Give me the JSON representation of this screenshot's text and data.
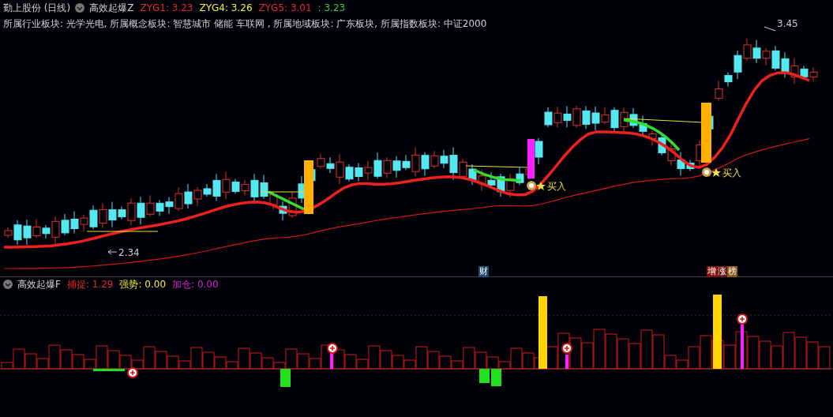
{
  "header": {
    "title": "勤上股份 (日线)",
    "indicator": "高效起爆Z",
    "values": [
      {
        "text": "ZYG1: 3.23",
        "color": "#e8262a"
      },
      {
        "text": "ZYG4: 3.26",
        "color": "#f2f23a"
      },
      {
        "text": "ZYG5: 3.01",
        "color": "#e8262a"
      },
      {
        "text": ": 3.23",
        "color": "#36d236"
      }
    ]
  },
  "sectors": "所属行业板块: 光学光电, 所属概念板块: 智慧城市 储能 车联网 , 所属地域板块: 广东板块, 所属指数板块: 中证2000",
  "annotations": {
    "low": "2.34",
    "high": "3.45",
    "buy_signals": [
      "买入",
      "买入"
    ]
  },
  "badges": [
    {
      "text": "财",
      "color": "#1d4a6e"
    }
  ],
  "badges_right": [
    {
      "text": "增",
      "color": "#8a1010"
    },
    {
      "text": "涨",
      "color": "#6e1414"
    },
    {
      "text": "榜",
      "color": "#8a5a14"
    }
  ],
  "sub_panel": {
    "indicator": "高效起爆F",
    "values": [
      {
        "text": "捕捉: 1.29",
        "color": "#e8262a"
      },
      {
        "text": "强势: 0.00",
        "color": "#f2f23a"
      },
      {
        "text": "加仓: 0.00",
        "color": "#e020d0"
      }
    ]
  }
}
